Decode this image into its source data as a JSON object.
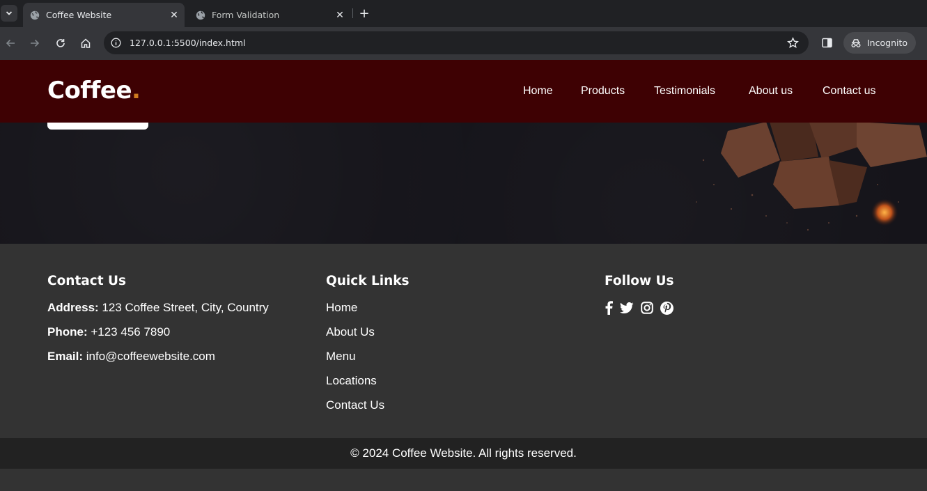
{
  "browser": {
    "tabs": [
      {
        "title": "Coffee Website",
        "active": true
      },
      {
        "title": "Form Validation",
        "active": false
      }
    ],
    "url": "127.0.0.1:5500/index.html",
    "incognito_label": "Incognito"
  },
  "header": {
    "logo_text": "Coffee",
    "logo_dot": ".",
    "nav": [
      "Home",
      "Products",
      "Testimonials",
      "About us",
      "Contact us"
    ]
  },
  "footer": {
    "contact": {
      "heading": "Contact Us",
      "address_label": "Address:",
      "address_value": "123 Coffee Street, City, Country",
      "phone_label": "Phone:",
      "phone_value": "+123 456 7890",
      "email_label": "Email:",
      "email_value": "info@coffeewebsite.com"
    },
    "quick_links": {
      "heading": "Quick Links",
      "items": [
        "Home",
        "About Us",
        "Menu",
        "Locations",
        "Contact Us"
      ]
    },
    "follow": {
      "heading": "Follow Us",
      "icons": [
        "facebook-icon",
        "twitter-icon",
        "instagram-icon",
        "pinterest-icon"
      ]
    },
    "copyright": "© 2024 Coffee Website. All rights reserved."
  },
  "colors": {
    "header_bg": "#3e0103",
    "accent": "#d07b1f",
    "footer_bg": "#333333",
    "copyright_bg": "#222222"
  }
}
